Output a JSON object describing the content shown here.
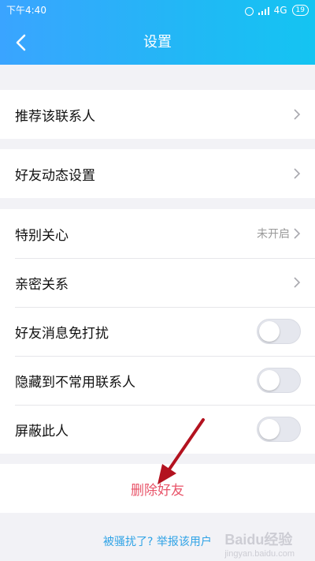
{
  "status_bar": {
    "time": "下午4:40",
    "network": "4G",
    "battery": "19"
  },
  "header": {
    "title": "设置"
  },
  "groups": [
    {
      "items": [
        {
          "label": "推荐该联系人",
          "type": "link"
        }
      ]
    },
    {
      "items": [
        {
          "label": "好友动态设置",
          "type": "link"
        }
      ]
    },
    {
      "items": [
        {
          "label": "特别关心",
          "type": "link",
          "value": "未开启"
        },
        {
          "label": "亲密关系",
          "type": "link"
        },
        {
          "label": "好友消息免打扰",
          "type": "toggle",
          "on": false
        },
        {
          "label": "隐藏到不常用联系人",
          "type": "toggle",
          "on": false
        },
        {
          "label": "屏蔽此人",
          "type": "toggle",
          "on": false
        }
      ]
    }
  ],
  "delete_friend": "删除好友",
  "report_link": "被骚扰了? 举报该用户",
  "watermark": {
    "text": "Baidu经验",
    "sub": "jingyan.baidu.com"
  },
  "colors": {
    "header_start": "#3aa4ff",
    "header_end": "#14c4f2",
    "delete": "#e85469",
    "link": "#2fa3e6",
    "annotation_arrow": "#b3121f"
  }
}
